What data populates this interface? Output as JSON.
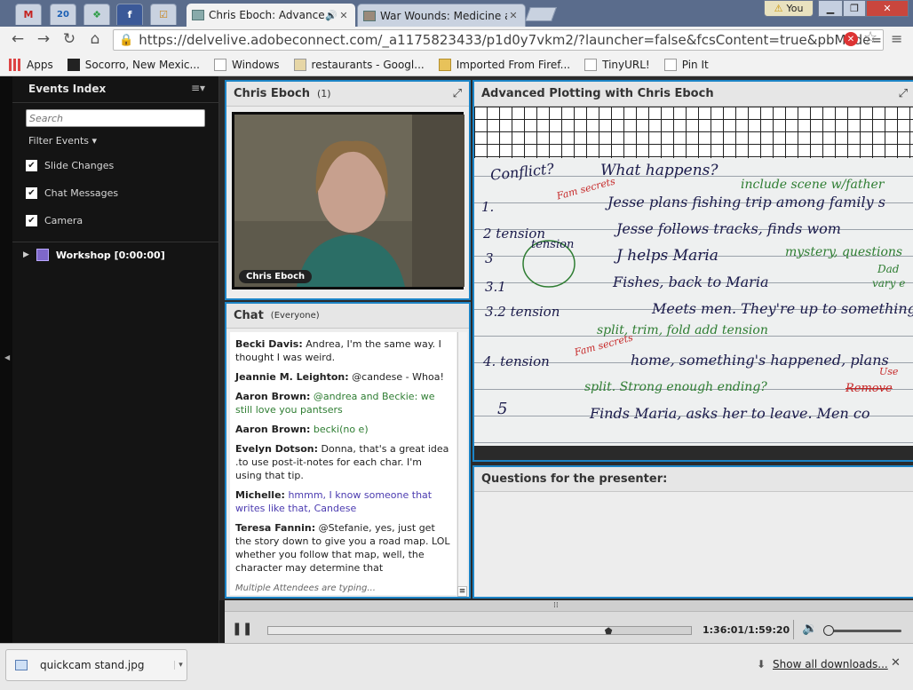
{
  "browser": {
    "tabs": [
      {
        "title": "Chris Eboch: Advanced",
        "state": "active"
      },
      {
        "title": "War Wounds: Medicine ar",
        "state": "inactive"
      }
    ],
    "pinned_tabs": [
      "gmail-icon",
      "calendar-icon",
      "feedly-icon",
      "facebook-icon",
      "tasks-icon"
    ],
    "calendar_day": "20",
    "profile_label": "You",
    "url": "https://delvelive.adobeconnect.com/_a1175823433/p1d0y7vkm2/?launcher=false&fcsContent=true&pbMode=",
    "bookmarks": [
      "Apps",
      "Socorro, New Mexic...",
      "Windows",
      "restaurants - Googl...",
      "Imported From Firef...",
      "TinyURL!",
      "Pin It"
    ]
  },
  "events_index": {
    "title": "Events Index",
    "search_placeholder": "Search",
    "filter_label": "Filter Events",
    "filters": [
      {
        "label": "Slide Changes",
        "checked": true
      },
      {
        "label": "Chat Messages",
        "checked": true
      },
      {
        "label": "Camera",
        "checked": true
      }
    ],
    "workshop_label": "Workshop [0:00:00]"
  },
  "camera_pod": {
    "title": "Chris Eboch",
    "count": "(1)",
    "name_tag": "Chris Eboch"
  },
  "chat_pod": {
    "title": "Chat",
    "scope": "(Everyone)",
    "messages": [
      {
        "author": "Becki Davis:",
        "text": "Andrea, I'm the same way. I thought I was weird.",
        "color": "#222222"
      },
      {
        "author": "Jeannie M. Leighton:",
        "text": "@candese - Whoa!",
        "color": "#222222"
      },
      {
        "author": "Aaron Brown:",
        "text": "@andrea and Beckie: we still love you pantsers",
        "color": "#2e7d32"
      },
      {
        "author": "Aaron Brown:",
        "text": "becki(no e)",
        "color": "#2e7d32"
      },
      {
        "author": "Evelyn Dotson:",
        "text": "Donna, that's a great idea .to use post-it-notes for each char. I'm using that tip.",
        "color": "#222222"
      },
      {
        "author": "Michelle:",
        "text": "hmmm, I know someone that writes like that, Candese",
        "color": "#4b3bb0"
      },
      {
        "author": "Teresa Fannin:",
        "text": "@Stefanie, yes, just get the story down to give you a road map. LOL whether you follow that map, well, the character may determine that",
        "color": "#222222"
      }
    ],
    "typing": "Multiple Attendees are typing..."
  },
  "share_pod": {
    "title": "Advanced Plotting with Chris Eboch",
    "notes": [
      {
        "text": "Conflict?",
        "color": "#1a1a4a"
      },
      {
        "text": "What happens?",
        "color": "#1a1a4a"
      },
      {
        "text": "include scene w/father",
        "color": "#2e7d32"
      },
      {
        "text": "1.",
        "color": "#1a1a4a"
      },
      {
        "text": "Fam secrets",
        "color": "#c62828"
      },
      {
        "text": "Jesse plans fishing trip among family s",
        "color": "#1a1a4a"
      },
      {
        "text": "2 tension",
        "color": "#1a1a4a"
      },
      {
        "text": "Jesse follows tracks, finds wom",
        "color": "#1a1a4a"
      },
      {
        "text": "3",
        "color": "#1a1a4a"
      },
      {
        "text": "tension",
        "color": "#1a1a4a"
      },
      {
        "text": "J helps Maria",
        "color": "#1a1a4a"
      },
      {
        "text": "mystery, questions",
        "color": "#2e7d32"
      },
      {
        "text": "Dad",
        "color": "#2e7d32"
      },
      {
        "text": "vary e",
        "color": "#2e7d32"
      },
      {
        "text": "3.1",
        "color": "#1a1a4a"
      },
      {
        "text": "Fishes, back to Maria",
        "color": "#1a1a4a"
      },
      {
        "text": "3.2 tension",
        "color": "#1a1a4a"
      },
      {
        "text": "Meets men. They're up to something",
        "color": "#1a1a4a"
      },
      {
        "text": "split, trim, fold  add tension",
        "color": "#2e7d32"
      },
      {
        "text": "4. tension",
        "color": "#1a1a4a"
      },
      {
        "text": "Fam secrets",
        "color": "#c62828"
      },
      {
        "text": "home, something's happened, plans",
        "color": "#1a1a4a"
      },
      {
        "text": "split. Strong enough ending?",
        "color": "#2e7d32"
      },
      {
        "text": "Remove",
        "color": "#c62828"
      },
      {
        "text": "Use",
        "color": "#c62828"
      },
      {
        "text": "5",
        "color": "#1a1a4a"
      },
      {
        "text": "Finds Maria, asks her to leave. Men co",
        "color": "#1a1a4a"
      }
    ]
  },
  "qa_pod": {
    "title": "Questions for the presenter:"
  },
  "player": {
    "time": "1:36:01/1:59:20",
    "progress": 0.805,
    "volume": 0.05
  },
  "downloads": {
    "file_name": "quickcam stand.jpg",
    "show_all": "Show all downloads..."
  }
}
